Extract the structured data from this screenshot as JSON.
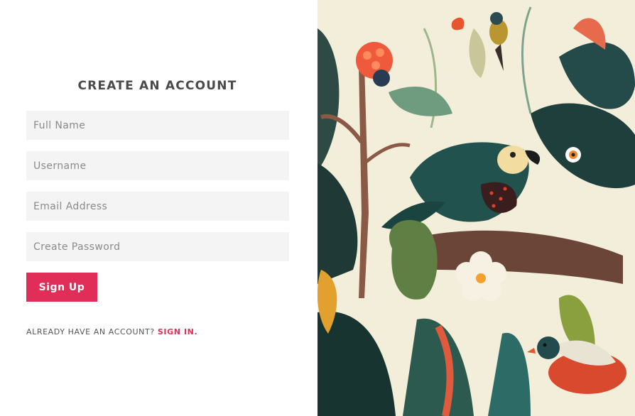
{
  "form": {
    "title": "CREATE AN ACCOUNT",
    "fields": [
      {
        "placeholder": "Full Name"
      },
      {
        "placeholder": "Username"
      },
      {
        "placeholder": "Email Address"
      },
      {
        "placeholder": "Create Password"
      }
    ],
    "submit_label": "Sign Up",
    "signin_prompt": "ALREADY HAVE AN ACCOUNT?",
    "signin_link": "SIGN IN."
  },
  "colors": {
    "accent": "#e02e59",
    "input_bg": "#f4f4f4",
    "title": "#4a4a4a",
    "art_bg": "#f3eed9"
  },
  "illustration": {
    "icon": "jungle-birds-illustration"
  }
}
